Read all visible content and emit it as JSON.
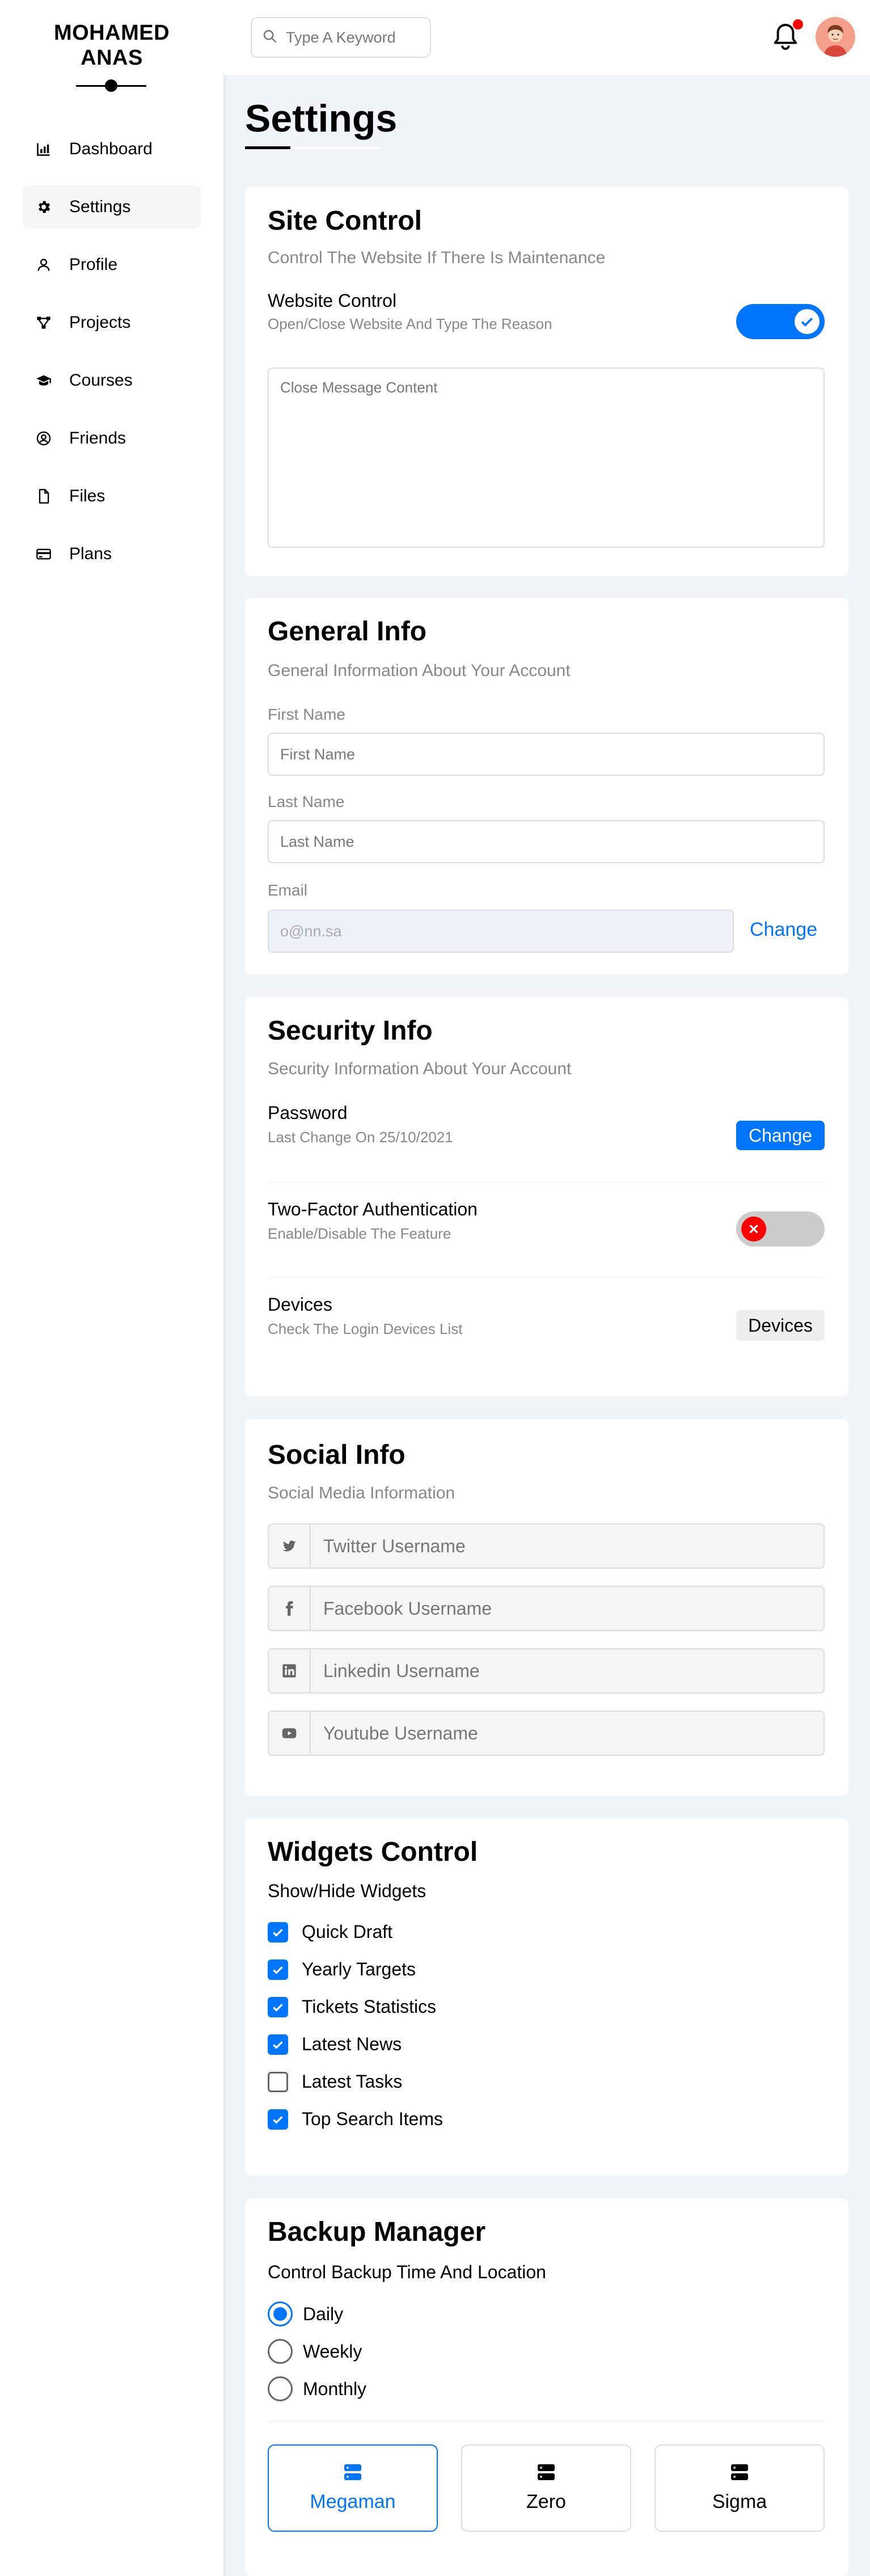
{
  "sidebar": {
    "brand_line1": "MOHAMED",
    "brand_line2": "ANAS",
    "items": [
      {
        "label": "Dashboard",
        "icon": "chart-icon"
      },
      {
        "label": "Settings",
        "icon": "gear-icon"
      },
      {
        "label": "Profile",
        "icon": "user-icon"
      },
      {
        "label": "Projects",
        "icon": "diagram-icon"
      },
      {
        "label": "Courses",
        "icon": "graduation-cap-icon"
      },
      {
        "label": "Friends",
        "icon": "user-circle-icon"
      },
      {
        "label": "Files",
        "icon": "file-icon"
      },
      {
        "label": "Plans",
        "icon": "credit-card-icon"
      }
    ]
  },
  "topbar": {
    "search_placeholder": "Type A Keyword"
  },
  "page_title": "Settings",
  "site_control": {
    "title": "Site Control",
    "subtitle": "Control The Website If There Is Maintenance",
    "row_title": "Website Control",
    "row_desc": "Open/Close Website And Type The Reason",
    "toggle_on": true,
    "textarea_placeholder": "Close Message Content"
  },
  "general_info": {
    "title": "General Info",
    "subtitle": "General Information About Your Account",
    "first_name_label": "First Name",
    "first_name_placeholder": "First Name",
    "last_name_label": "Last Name",
    "last_name_placeholder": "Last Name",
    "email_label": "Email",
    "email_placeholder": "o@nn.sa",
    "change_label": "Change"
  },
  "security_info": {
    "title": "Security Info",
    "subtitle": "Security Information About Your Account",
    "password_title": "Password",
    "password_desc": "Last Change On 25/10/2021",
    "password_button": "Change",
    "tfa_title": "Two-Factor Authentication",
    "tfa_desc": "Enable/Disable The Feature",
    "tfa_on": false,
    "devices_title": "Devices",
    "devices_desc": "Check The Login Devices List",
    "devices_button": "Devices"
  },
  "social_info": {
    "title": "Social Info",
    "subtitle": "Social Media Information",
    "fields": [
      {
        "icon": "twitter-icon",
        "placeholder": "Twitter Username"
      },
      {
        "icon": "facebook-icon",
        "placeholder": "Facebook Username"
      },
      {
        "icon": "linkedin-icon",
        "placeholder": "Linkedin Username"
      },
      {
        "icon": "youtube-icon",
        "placeholder": "Youtube Username"
      }
    ]
  },
  "widgets_control": {
    "title": "Widgets Control",
    "subtitle": "Show/Hide Widgets",
    "items": [
      {
        "label": "Quick Draft",
        "checked": true
      },
      {
        "label": "Yearly Targets",
        "checked": true
      },
      {
        "label": "Tickets Statistics",
        "checked": true
      },
      {
        "label": "Latest News",
        "checked": true
      },
      {
        "label": "Latest Tasks",
        "checked": false
      },
      {
        "label": "Top Search Items",
        "checked": true
      }
    ]
  },
  "backup_manager": {
    "title": "Backup Manager",
    "subtitle": "Control Backup Time And Location",
    "options": [
      {
        "label": "Daily",
        "selected": true
      },
      {
        "label": "Weekly",
        "selected": false
      },
      {
        "label": "Monthly",
        "selected": false
      }
    ],
    "servers": [
      {
        "label": "Megaman",
        "selected": true
      },
      {
        "label": "Zero",
        "selected": false
      },
      {
        "label": "Sigma",
        "selected": false
      }
    ]
  },
  "colors": {
    "accent": "#0075ff",
    "danger": "#ff0000",
    "background": "#f1f5f9"
  }
}
